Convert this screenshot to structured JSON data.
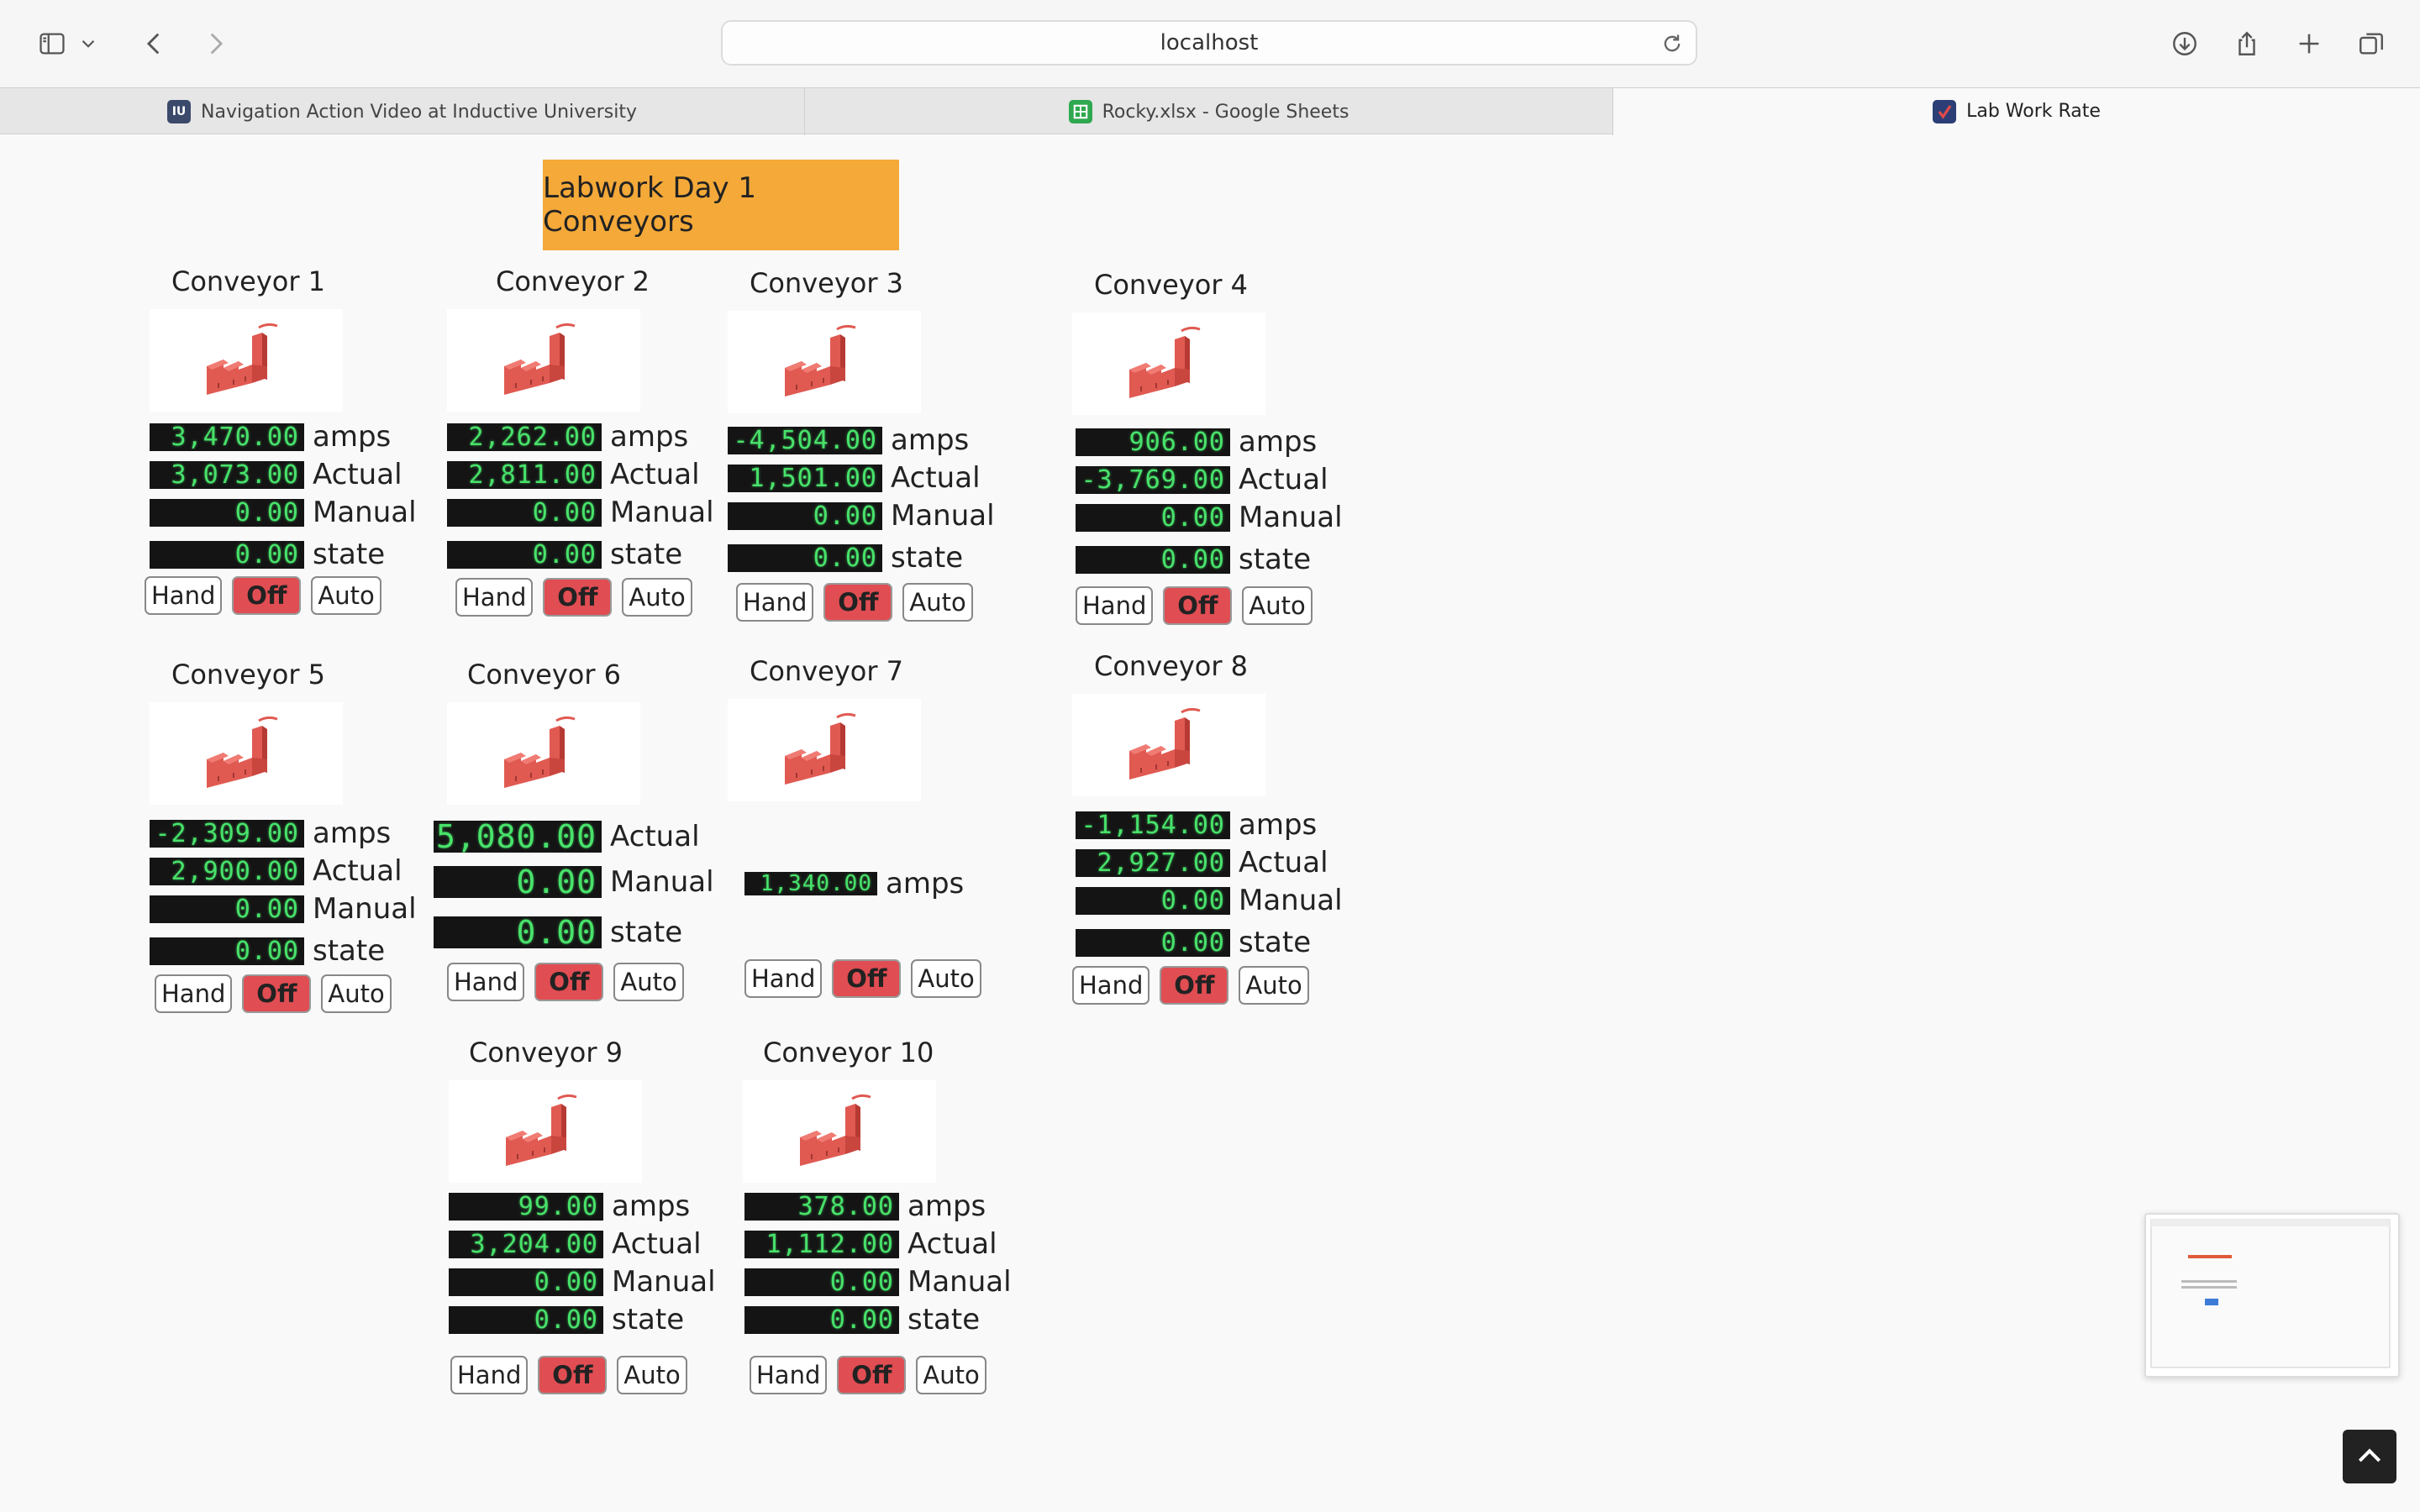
{
  "browser": {
    "url": "localhost",
    "tabs": [
      {
        "title": "Navigation Action Video at Inductive University",
        "favicon": "IU",
        "active": false
      },
      {
        "title": "Rocky.xlsx - Google Sheets",
        "favicon": "sheets",
        "active": false
      },
      {
        "title": "Lab Work Rate",
        "favicon": "checkmark",
        "active": true
      }
    ],
    "icons": [
      "sidebar-icon",
      "chevron-down-icon",
      "back-icon",
      "forward-icon",
      "reload-icon",
      "download-icon",
      "share-icon",
      "new-tab-icon",
      "tab-overview-icon"
    ]
  },
  "page": {
    "title": "Labwork Day 1 Conveyors",
    "labels": {
      "amps": "amps",
      "actual": "Actual",
      "manual": "Manual",
      "state": "state"
    },
    "buttons": {
      "hand": "Hand",
      "off": "Off",
      "auto": "Auto"
    },
    "colors": {
      "title_bg": "#f4a939",
      "off_button": "#e04d52",
      "lcd_bg": "#141414",
      "lcd_text": "#48e26a",
      "icon": "#e05a52"
    }
  },
  "conveyors": [
    {
      "name": "Conveyor 1",
      "amps": "3,470.00",
      "actual": "3,073.00",
      "manual": "0.00",
      "state": "0.00"
    },
    {
      "name": "Conveyor 2",
      "amps": "2,262.00",
      "actual": "2,811.00",
      "manual": "0.00",
      "state": "0.00"
    },
    {
      "name": "Conveyor 3",
      "amps": "-4,504.00",
      "actual": "1,501.00",
      "manual": "0.00",
      "state": "0.00"
    },
    {
      "name": "Conveyor 4",
      "amps": "906.00",
      "actual": "-3,769.00",
      "manual": "0.00",
      "state": "0.00"
    },
    {
      "name": "Conveyor 5",
      "amps": "-2,309.00",
      "actual": "2,900.00",
      "manual": "0.00",
      "state": "0.00"
    },
    {
      "name": "Conveyor 6",
      "actual": "5,080.00",
      "manual": "0.00",
      "state": "0.00"
    },
    {
      "name": "Conveyor 7",
      "amps": "1,340.00"
    },
    {
      "name": "Conveyor 8",
      "amps": "-1,154.00",
      "actual": "2,927.00",
      "manual": "0.00",
      "state": "0.00"
    },
    {
      "name": "Conveyor 9",
      "amps": "99.00",
      "actual": "3,204.00",
      "manual": "0.00",
      "state": "0.00"
    },
    {
      "name": "Conveyor 10",
      "amps": "378.00",
      "actual": "1,112.00",
      "manual": "0.00",
      "state": "0.00"
    }
  ]
}
